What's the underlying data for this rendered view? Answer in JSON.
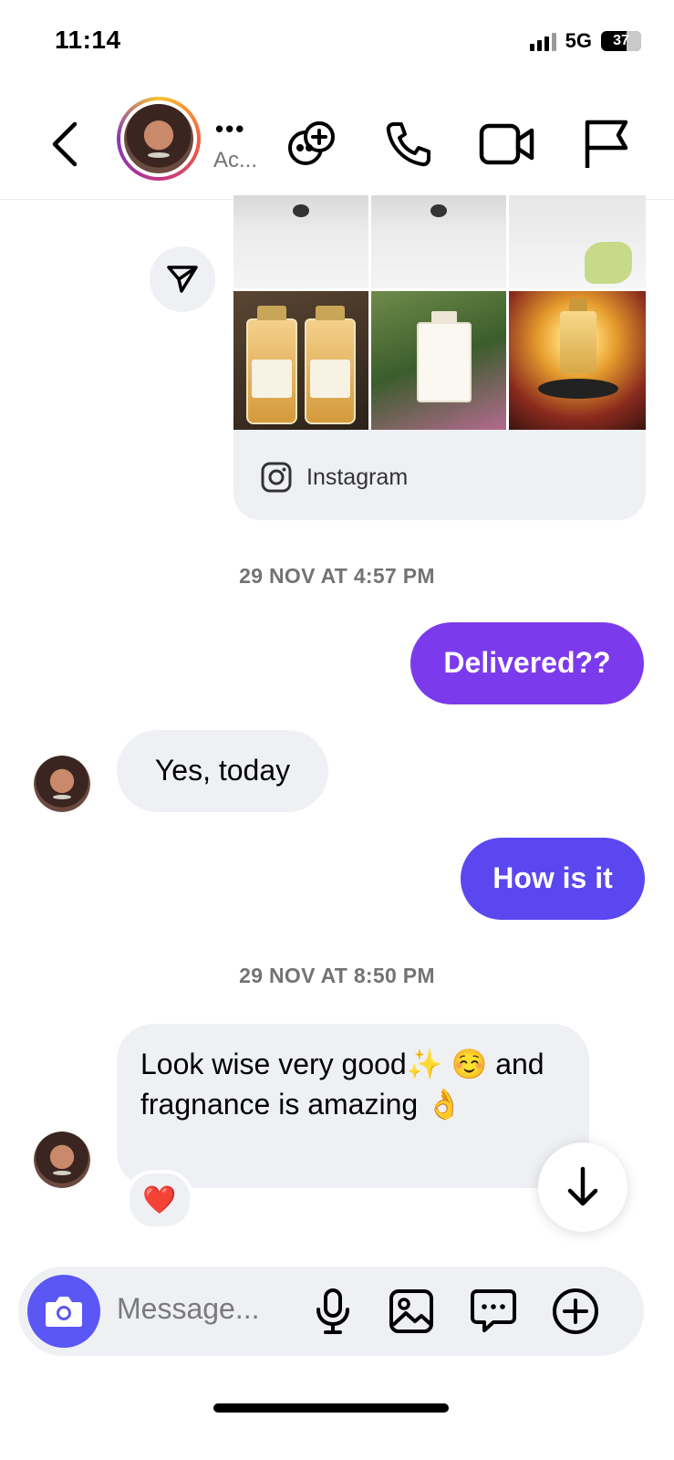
{
  "status_bar": {
    "time": "11:14",
    "network": "5G",
    "battery": "37"
  },
  "header": {
    "name": "•••",
    "subtitle": "Ac..."
  },
  "shared_post": {
    "source": "Instagram"
  },
  "thread": {
    "timestamp_1": "29 NOV AT 4:57 PM",
    "timestamp_2": "29 NOV AT 8:50 PM",
    "msg_delivered": "Delivered??",
    "msg_yes_today": "Yes, today",
    "msg_how_is_it": "How is it",
    "msg_look_wise": "Look wise very good✨ ☺️ and fragnance is amazing 👌",
    "reaction": "❤️"
  },
  "composer": {
    "placeholder": "Message..."
  },
  "colors": {
    "accent_bubble_1": "#7c3aed",
    "accent_bubble_2": "#5b47f0",
    "camera_button": "#5a57f5"
  }
}
